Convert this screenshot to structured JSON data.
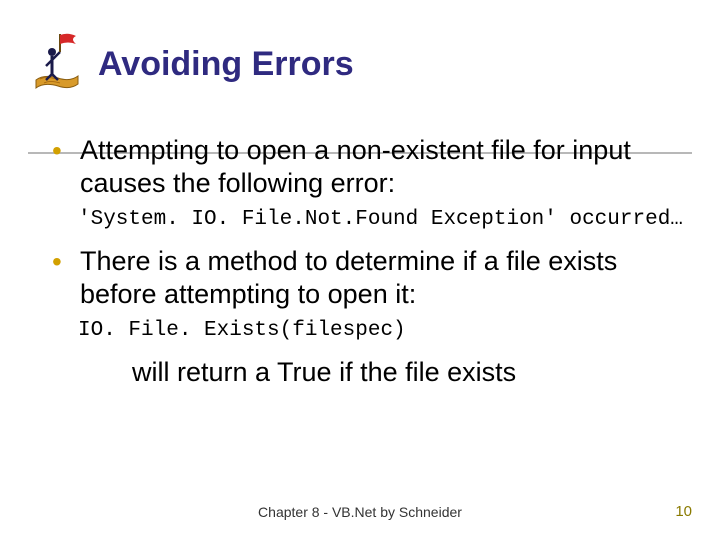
{
  "slide": {
    "title": "Avoiding Errors",
    "icon": "flag-on-carpet-icon",
    "bullets": [
      {
        "text": "Attempting to open a non-existent file for input causes the following error:",
        "code": "'System. IO. File.Not.Found Exception' occurred…"
      },
      {
        "text": "There is a method to determine if a file exists before attempting to open it:",
        "code": "IO. File. Exists(filespec)",
        "sub": "will return a True if the file exists"
      }
    ],
    "footer": "Chapter 8 - VB.Net by Schneider",
    "page_number": "10"
  }
}
